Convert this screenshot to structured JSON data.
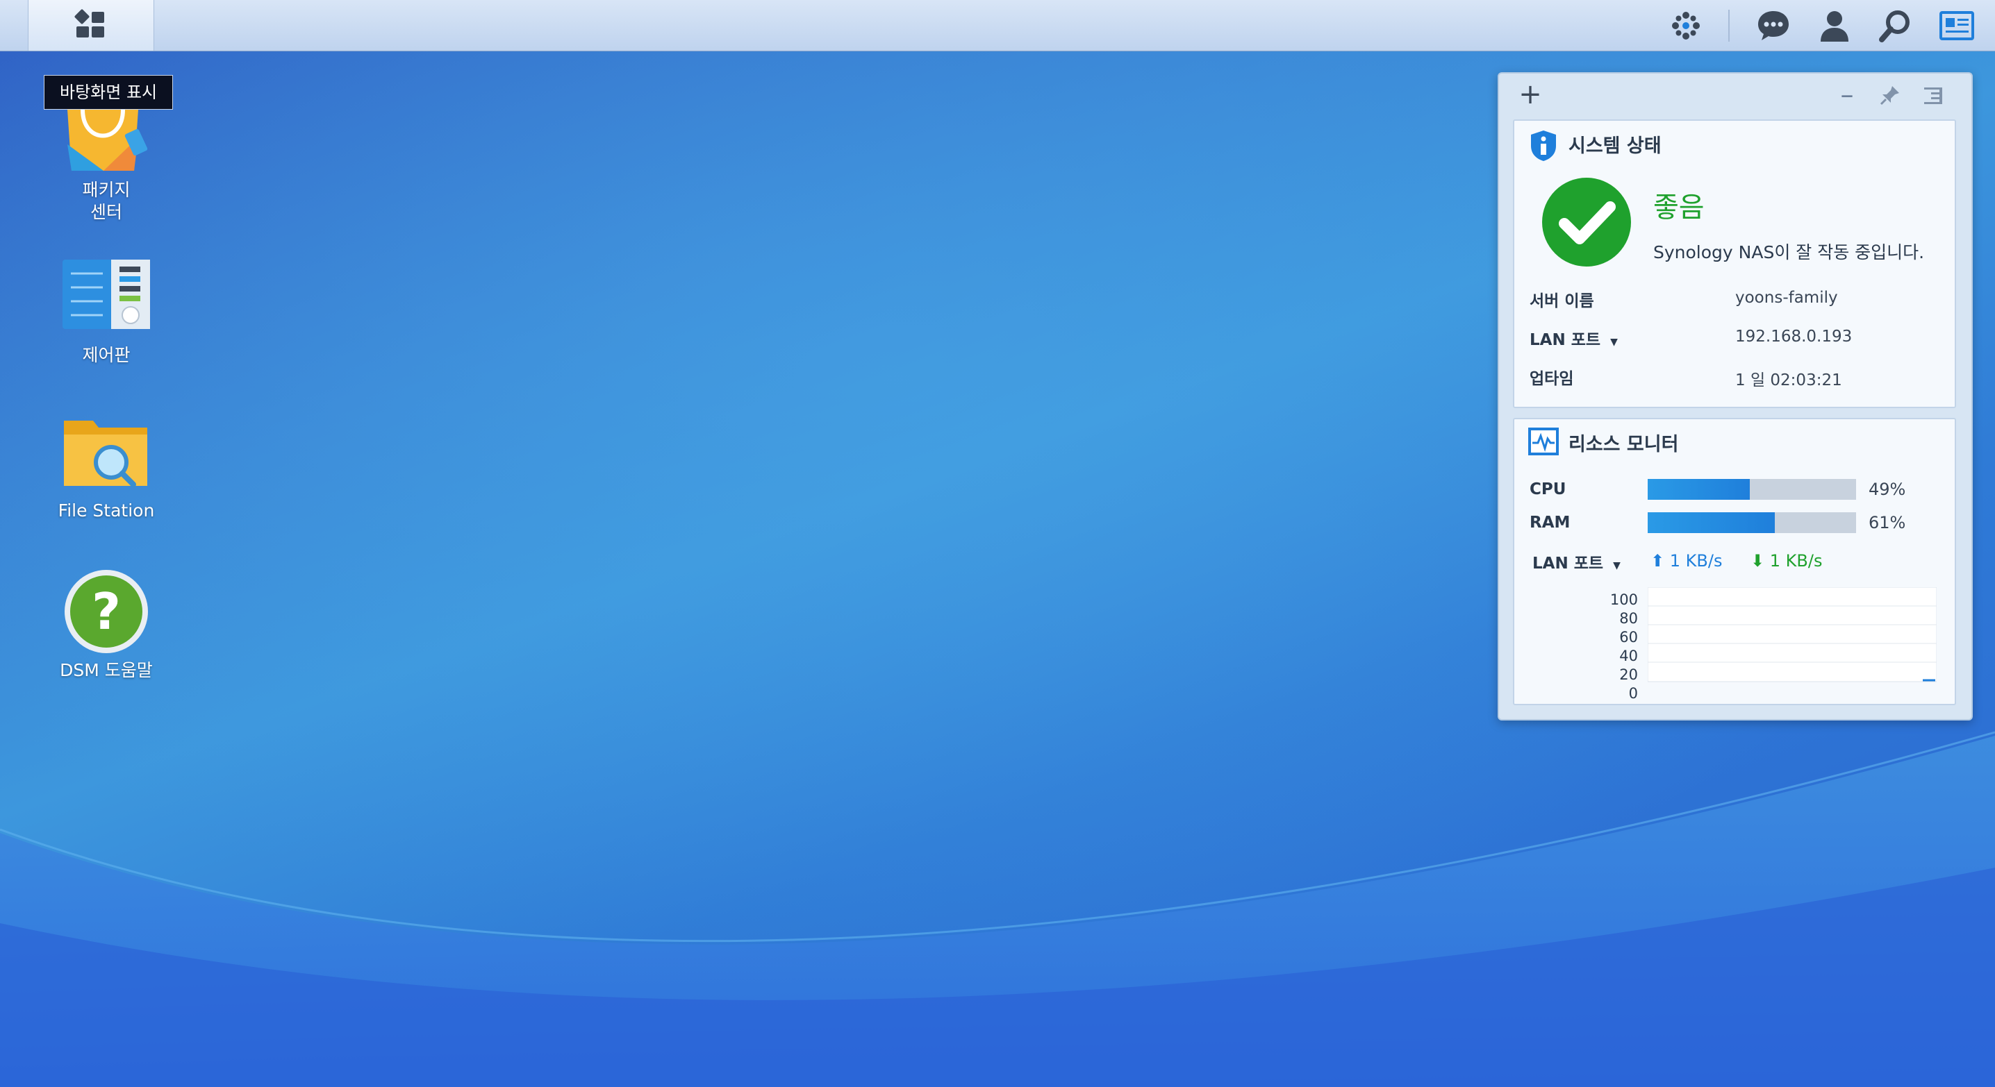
{
  "taskbar": {
    "main_menu_icon": "main-menu-icon",
    "right_icons": [
      "widgets-icon",
      "notification-chat-icon",
      "user-icon",
      "search-icon",
      "show-desktop-card-icon"
    ]
  },
  "tooltip": {
    "text": "바탕화면 표시"
  },
  "desktop": {
    "icons": [
      {
        "label": "패키지\n센터",
        "icon": "package-center-icon"
      },
      {
        "label": "제어판",
        "icon": "control-panel-icon"
      },
      {
        "label": "File Station",
        "icon": "file-station-icon"
      },
      {
        "label": "DSM 도움말",
        "icon": "dsm-help-icon"
      }
    ]
  },
  "widgets": {
    "toolbar": {
      "add": "+",
      "minimize": "–"
    },
    "system_status": {
      "title": "시스템 상태",
      "status": "좋음",
      "message": "Synology NAS이 잘 작동 중입니다.",
      "rows": [
        {
          "label": "서버 이름",
          "value": "yoons-family"
        },
        {
          "label": "LAN 포트",
          "value": "192.168.0.193"
        },
        {
          "label": "업타임",
          "value": "1 일 02:03:21"
        }
      ],
      "colors": {
        "ok": "#1fa12d",
        "shield": "#1f7fdb"
      }
    },
    "resource_monitor": {
      "title": "리소스 모니터",
      "cpu": {
        "label": "CPU",
        "percent": 49,
        "text": "49%"
      },
      "ram": {
        "label": "RAM",
        "percent": 61,
        "text": "61%"
      },
      "lan": {
        "label": "LAN 포트",
        "upload": "1 KB/s",
        "download": "1 KB/s"
      },
      "chart_axis": [
        "100",
        "80",
        "60",
        "40",
        "20",
        "0"
      ],
      "colors": {
        "upload": "#1f7fdb",
        "download": "#1fa12d",
        "bar": "#1f7fdb"
      }
    }
  }
}
